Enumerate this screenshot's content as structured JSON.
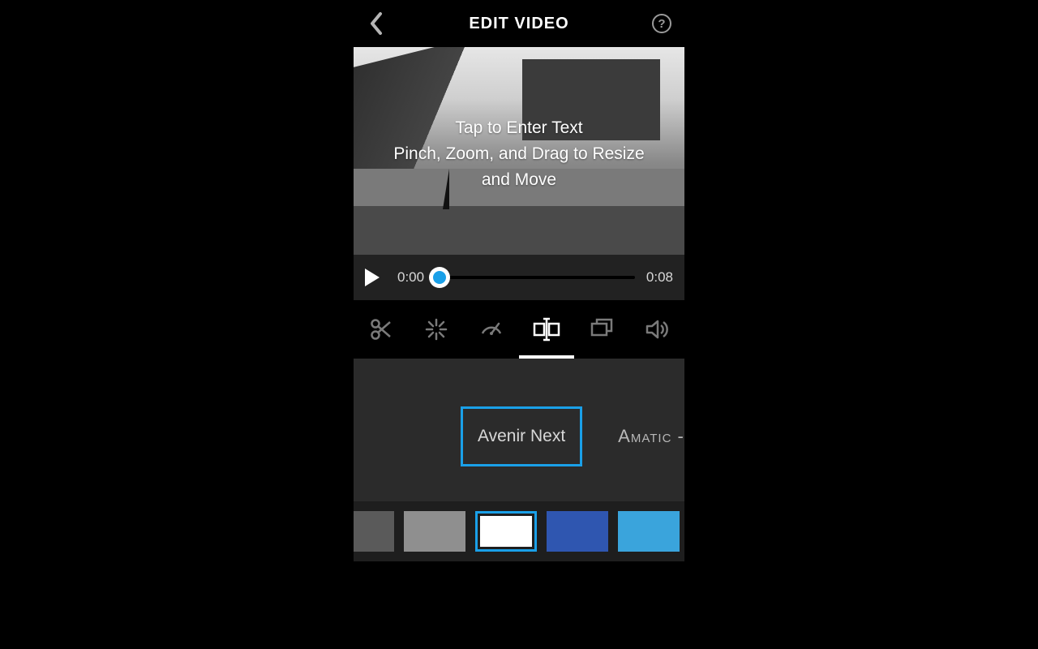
{
  "header": {
    "title": "EDIT VIDEO",
    "help_glyph": "?"
  },
  "preview": {
    "overlay_line1": "Tap to Enter Text",
    "overlay_line2": "Pinch, Zoom, and Drag to Resize and Move"
  },
  "player": {
    "current_time": "0:00",
    "duration": "0:08",
    "progress_percent": 2
  },
  "tools": {
    "items": [
      {
        "name": "trim",
        "active": false
      },
      {
        "name": "effects",
        "active": false
      },
      {
        "name": "speed",
        "active": false
      },
      {
        "name": "text",
        "active": true
      },
      {
        "name": "crop",
        "active": false
      },
      {
        "name": "audio",
        "active": false
      }
    ]
  },
  "fonts": {
    "selected": "Avenir Next",
    "next": "Amatic - Bold"
  },
  "colors": {
    "swatches": [
      "#5a5a5a",
      "#8f8f8f",
      "#ffffff",
      "#2f56b0",
      "#3aa4dc"
    ],
    "selected_index": 2
  },
  "accent": "#1aa0e8"
}
